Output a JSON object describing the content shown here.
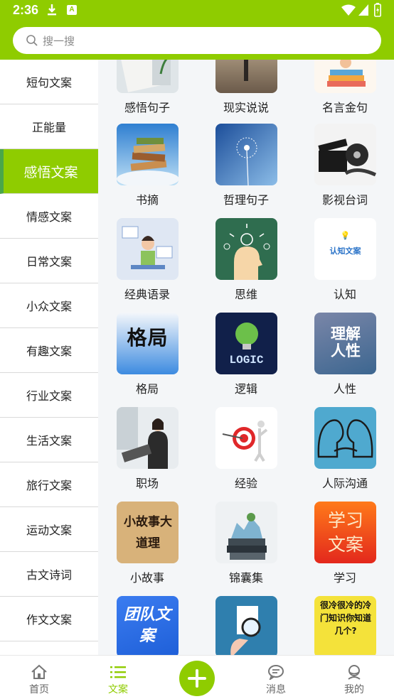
{
  "status": {
    "time": "2:36"
  },
  "search": {
    "placeholder": "搜一搜"
  },
  "sidebar": {
    "items": [
      {
        "label": "短句文案"
      },
      {
        "label": "正能量"
      },
      {
        "label": "感悟文案",
        "active": true
      },
      {
        "label": "情感文案"
      },
      {
        "label": "日常文案"
      },
      {
        "label": "小众文案"
      },
      {
        "label": "有趣文案"
      },
      {
        "label": "行业文案"
      },
      {
        "label": "生活文案"
      },
      {
        "label": "旅行文案"
      },
      {
        "label": "运动文案"
      },
      {
        "label": "古文诗词"
      },
      {
        "label": "作文文案"
      }
    ]
  },
  "grid": {
    "tiles": [
      {
        "label": "感悟句子",
        "thumb_text": ""
      },
      {
        "label": "现实说说",
        "thumb_text": ""
      },
      {
        "label": "名言金句",
        "thumb_text": ""
      },
      {
        "label": "书摘",
        "thumb_text": ""
      },
      {
        "label": "哲理句子",
        "thumb_text": ""
      },
      {
        "label": "影视台词",
        "thumb_text": ""
      },
      {
        "label": "经典语录",
        "thumb_text": ""
      },
      {
        "label": "思维",
        "thumb_text": ""
      },
      {
        "label": "认知",
        "thumb_text": "认知文案"
      },
      {
        "label": "格局",
        "thumb_text": "格局"
      },
      {
        "label": "逻辑",
        "thumb_text": "LOGIC"
      },
      {
        "label": "人性",
        "thumb_text": "理解人性"
      },
      {
        "label": "职场",
        "thumb_text": ""
      },
      {
        "label": "经验",
        "thumb_text": ""
      },
      {
        "label": "人际沟通",
        "thumb_text": ""
      },
      {
        "label": "小故事",
        "thumb_text": "小故事大道理"
      },
      {
        "label": "锦囊集",
        "thumb_text": ""
      },
      {
        "label": "学习",
        "thumb_text": "学习文案"
      },
      {
        "label": "",
        "thumb_text": "团队文案"
      },
      {
        "label": "",
        "thumb_text": ""
      },
      {
        "label": "",
        "thumb_text": "很冷很冷的冷门知识你知道几个?"
      }
    ]
  },
  "bottom_nav": {
    "home": "首页",
    "wenan": "文案",
    "messages": "消息",
    "mine": "我的"
  },
  "colors": {
    "accent": "#8fcc00",
    "active_bar": "#4aa74a"
  }
}
